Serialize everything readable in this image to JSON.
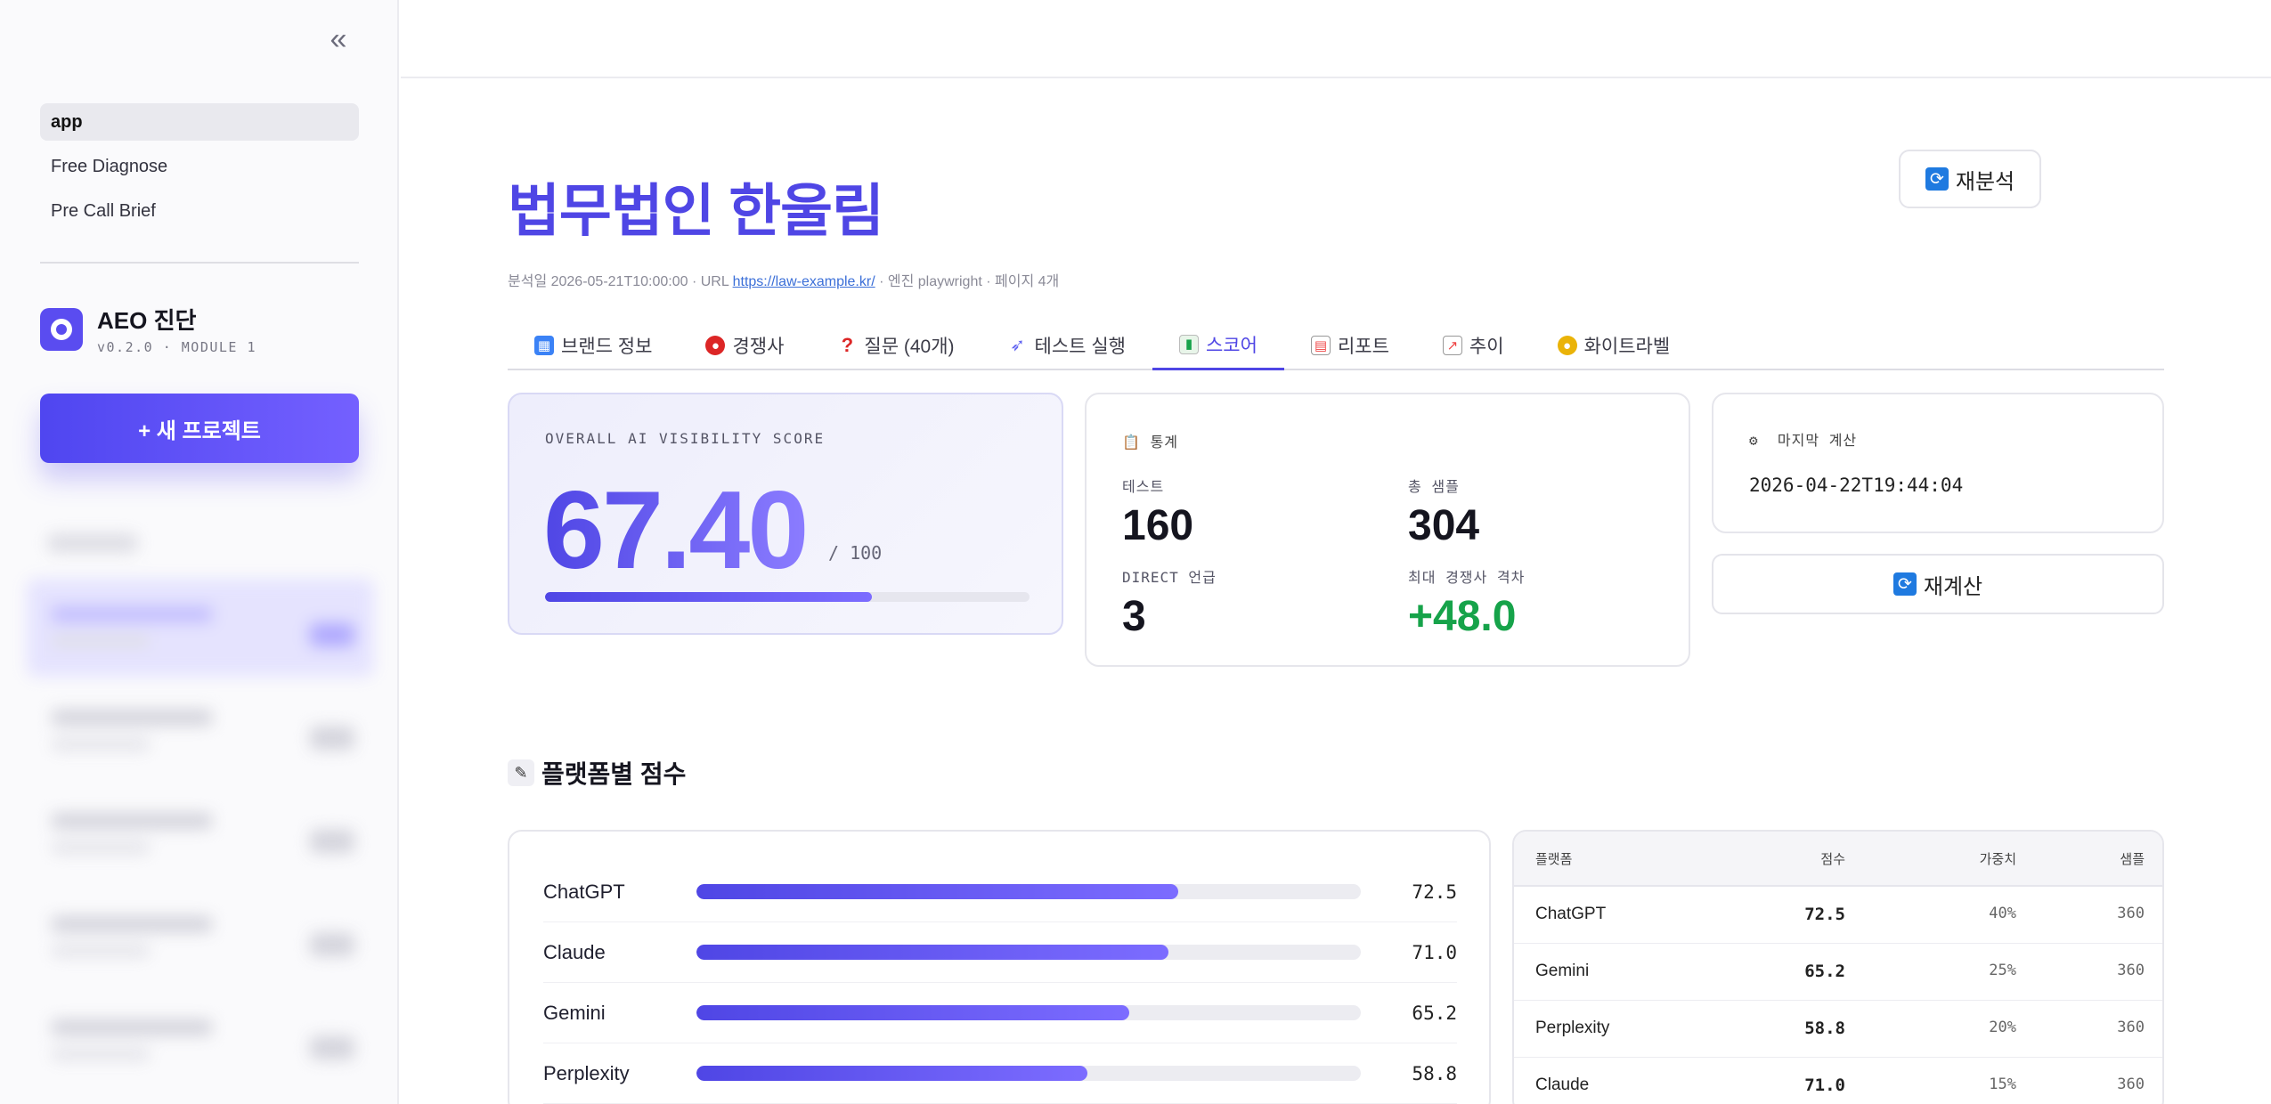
{
  "sidebar": {
    "nav": [
      {
        "label": "app"
      },
      {
        "label": "Free Diagnose"
      },
      {
        "label": "Pre Call Brief"
      }
    ],
    "brand": {
      "title": "AEO 진단",
      "subtitle": "v0.2.0 · MODULE 1"
    },
    "new_project_label": "+ 새 프로젝트"
  },
  "header": {
    "title": "법무법인 한울림",
    "reanalyze_label": "재분석",
    "meta": {
      "prefix": "분석일 2026-05-21T10:00:00 · URL ",
      "url": "https://law-example.kr/",
      "suffix": " · 엔진 playwright · 페이지 4개"
    }
  },
  "tabs": [
    {
      "label": "브랜드 정보",
      "icon": "building-icon",
      "color": "#3b82f6"
    },
    {
      "label": "경쟁사",
      "icon": "boxing-glove-icon",
      "color": "#dc2626"
    },
    {
      "label": "질문 (40개)",
      "icon": "question-icon",
      "color": "#dc2626"
    },
    {
      "label": "테스트 실행",
      "icon": "rocket-icon",
      "color": "#6366f1"
    },
    {
      "label": "스코어",
      "icon": "bar-chart-icon",
      "color": "#22c55e",
      "active": true
    },
    {
      "label": "리포트",
      "icon": "document-icon",
      "color": "#ef4444"
    },
    {
      "label": "추이",
      "icon": "line-chart-icon",
      "color": "#ef4444"
    },
    {
      "label": "화이트라벨",
      "icon": "palette-icon",
      "color": "#eab308"
    }
  ],
  "score": {
    "label": "OVERALL AI VISIBILITY SCORE",
    "value": "67.40",
    "max": "/ 100",
    "progress": 0.674
  },
  "stats": {
    "title": "통계",
    "items": [
      {
        "label": "테스트",
        "value": "160"
      },
      {
        "label": "총 샘플",
        "value": "304"
      },
      {
        "label": "DIRECT 언급",
        "value": "3"
      },
      {
        "label": "최대 경쟁사 격차",
        "value": "+48.0"
      }
    ]
  },
  "last_calc": {
    "title": "마지막 계산",
    "value": "2026-04-22T19:44:04"
  },
  "recalc_label": "재계산",
  "platform_section": {
    "title": "플랫폼별 점수",
    "bars": [
      {
        "name": "ChatGPT",
        "value": "72.5",
        "score": 72.5
      },
      {
        "name": "Claude",
        "value": "71.0",
        "score": 71.0
      },
      {
        "name": "Gemini",
        "value": "65.2",
        "score": 65.2
      },
      {
        "name": "Perplexity",
        "value": "58.8",
        "score": 58.8
      }
    ],
    "table": {
      "headers": [
        "플랫폼",
        "점수",
        "가중치",
        "샘플"
      ],
      "rows": [
        [
          "ChatGPT",
          "72.5",
          "40%",
          "360"
        ],
        [
          "Gemini",
          "65.2",
          "25%",
          "360"
        ],
        [
          "Perplexity",
          "58.8",
          "20%",
          "360"
        ],
        [
          "Claude",
          "71.0",
          "15%",
          "360"
        ]
      ]
    }
  }
}
